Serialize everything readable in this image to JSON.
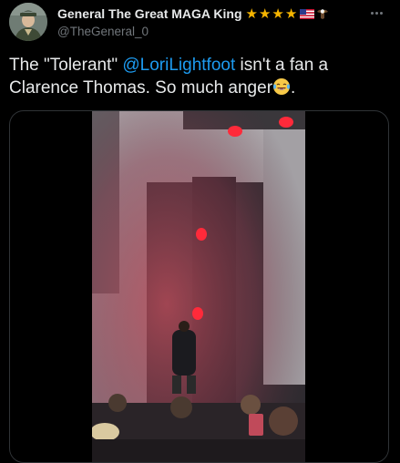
{
  "author": {
    "display_name": "General The Great MAGA King",
    "handle": "@TheGeneral_0",
    "badges": [
      "star",
      "star",
      "star",
      "star",
      "us-flag",
      "eagle"
    ]
  },
  "tweet": {
    "text_before": "The \"Tolerant\" ",
    "mention": "@LoriLightfoot",
    "text_after": " isn't a fan a Clarence Thomas. So much anger",
    "emoji": "face-with-tears-of-joy",
    "text_end": "."
  },
  "colors": {
    "background": "#000000",
    "text": "#e7e9ea",
    "secondary": "#71767b",
    "link": "#1d9bf0",
    "star": "#f5b400"
  }
}
